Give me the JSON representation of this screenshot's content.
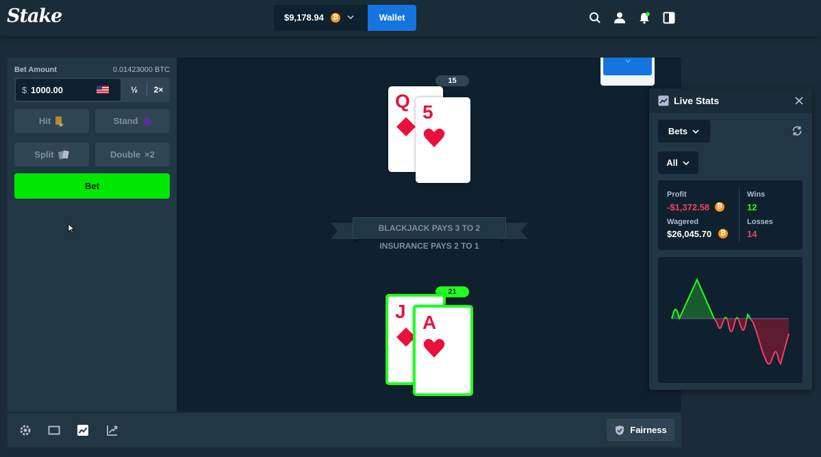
{
  "header": {
    "logo": "Stake",
    "balance": "$9,178.94",
    "wallet_label": "Wallet"
  },
  "bet_panel": {
    "bet_amount_label": "Bet Amount",
    "bet_amount_btc": "0.01423000 BTC",
    "currency_symbol": "$",
    "bet_value": "1000.00",
    "half_label": "½",
    "double_label": "2×",
    "hit_label": "Hit",
    "stand_label": "Stand",
    "split_label": "Split",
    "double_down_label": "Double",
    "double_multiplier": "×2",
    "bet_button_label": "Bet"
  },
  "table": {
    "dealer": {
      "score": "15",
      "cards": [
        {
          "rank": "Q",
          "suit": "diamonds"
        },
        {
          "rank": "5",
          "suit": "hearts"
        }
      ]
    },
    "player": {
      "score": "21",
      "cards": [
        {
          "rank": "J",
          "suit": "diamonds"
        },
        {
          "rank": "A",
          "suit": "hearts"
        }
      ]
    },
    "blackjack_text": "BLACKJACK PAYS 3 TO 2",
    "insurance_text": "INSURANCE PAYS 2 TO 1"
  },
  "footer": {
    "fairness_label": "Fairness"
  },
  "live_stats": {
    "title": "Live Stats",
    "filter_label": "Bets",
    "scope_label": "All",
    "profit_label": "Profit",
    "profit_value": "-$1,372.58",
    "wagered_label": "Wagered",
    "wagered_value": "$26,045.70",
    "wins_label": "Wins",
    "wins_value": "12",
    "losses_label": "Losses",
    "losses_value": "14"
  },
  "colors": {
    "accent_green": "#00e701",
    "loss_red": "#ed4163",
    "card_red": "#e9113c",
    "wallet_blue": "#1475e1",
    "btc_orange": "#f7931a"
  }
}
